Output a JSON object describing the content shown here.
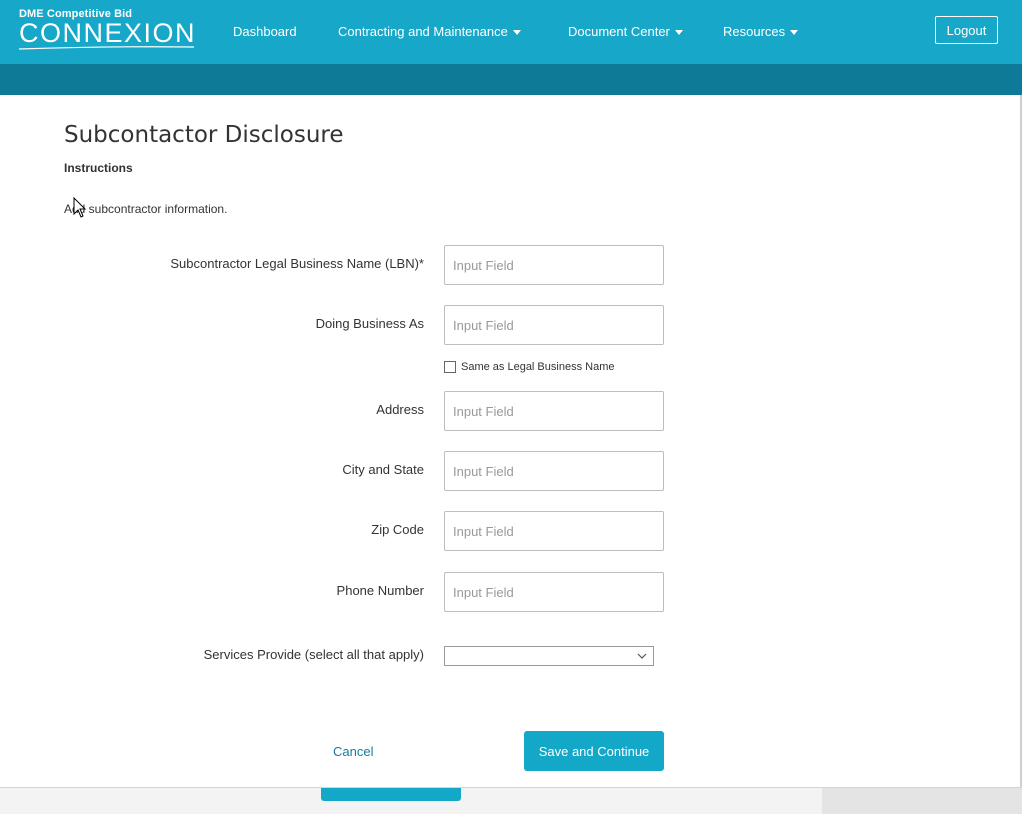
{
  "header": {
    "logo_small": "DME Competitive Bid",
    "logo_big": "CONNEXION",
    "nav": {
      "dashboard": "Dashboard",
      "contracting": "Contracting and Maintenance",
      "documents": "Document Center",
      "resources": "Resources"
    },
    "logout": "Logout"
  },
  "page": {
    "title": "Subcontactor Disclosure",
    "instructions_heading": "Instructions",
    "instructions_text": "Add subcontractor information."
  },
  "form": {
    "lbn_label": "Subcontractor Legal Business Name (LBN)*",
    "dba_label": "Doing Business As",
    "same_as_label": "Same as Legal Business Name",
    "address_label": "Address",
    "city_state_label": "City and State",
    "zip_label": "Zip Code",
    "phone_label": "Phone Number",
    "services_label": "Services Provide (select all that apply)",
    "placeholder": "Input Field",
    "services_value": ""
  },
  "actions": {
    "cancel": "Cancel",
    "save": "Save and Continue"
  },
  "colors": {
    "header": "#17a8c9",
    "subbar": "#0e7a97",
    "primary_button": "#13a7c8",
    "link": "#117e9e"
  }
}
